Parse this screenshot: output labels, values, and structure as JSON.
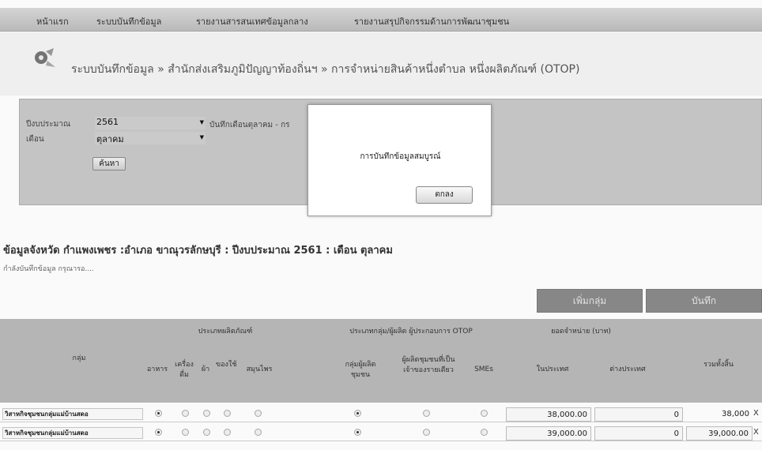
{
  "nav": {
    "items": [
      "หน้าแรก",
      "ระบบบันทึกข้อมูล",
      "รายงานสารสนเทศข้อมูลกลาง",
      "รายงานสรุปกิจกรรมด้านการพัฒนาชุมชน"
    ]
  },
  "breadcrumb": "ระบบบันทึกข้อมูล » สำนักส่งเสริมภูมิปัญญาท้องถิ่นฯ » การจำหน่ายสินค้าหนึ่งตำบล หนึ่งผลิตภัณฑ์ (OTOP)",
  "filter": {
    "year_label": "ปีงบประมาณ",
    "year_value": "2561",
    "month_label": "เดือน",
    "month_value": "ตุลาคม",
    "note": "บันทึกเดือนตุลาคม - กร",
    "search_label": "ค้นหา"
  },
  "modal": {
    "message": "การบันทึกข้อมูลสมบูรณ์",
    "ok_label": "ตกลง"
  },
  "section": {
    "title": "ข้อมูลจังหวัด กำแพงเพชร :อำเภอ ขาณุวรลักษบุรี : ปีงบประมาณ 2561 : เดือน ตุลาคม",
    "subtitle": "กำลังบันทึกข้อมูล กรุณารอ...."
  },
  "actions": {
    "add_group": "เพิ่มกลุ่ม",
    "save": "บันทึก"
  },
  "table": {
    "group_header": "กลุ่ม",
    "product_type_header": "ประเภทผลิตภัณฑ์",
    "producer_type_header": "ประเภทกลุ่ม/ผู้ผลิต ผู้ประกอบการ OTOP",
    "sales_header": "ยอดจำหน่าย (บาท)",
    "cols": {
      "food": "อาหาร",
      "drink": "เครื่องดื่ม",
      "cloth": "ผ้า",
      "utensil": "ของใช้",
      "herb": "สมุนไพร",
      "community": "กลุ่มผู้ผลิตชุมชน",
      "single": "ผู้ผลิตชุมชนที่เป็นเจ้าของรายเดียว",
      "smes": "SMEs",
      "domestic": "ในประเทศ",
      "foreign": "ต่างประเทศ",
      "total": "รวมทั้งสิ้น"
    },
    "rows": [
      {
        "name": "วิสาหกิจชุมชนกลุ่มแม่บ้านสดอ",
        "domestic": "38,000.00",
        "foreign": "0",
        "total": "38,000",
        "suffix": "X"
      },
      {
        "name": "วิสาหกิจชุมชนกลุ่มแม่บ้านสดอ",
        "domestic": "39,000.00",
        "foreign": "0",
        "total": "39,000.00",
        "suffix": "X"
      }
    ]
  }
}
